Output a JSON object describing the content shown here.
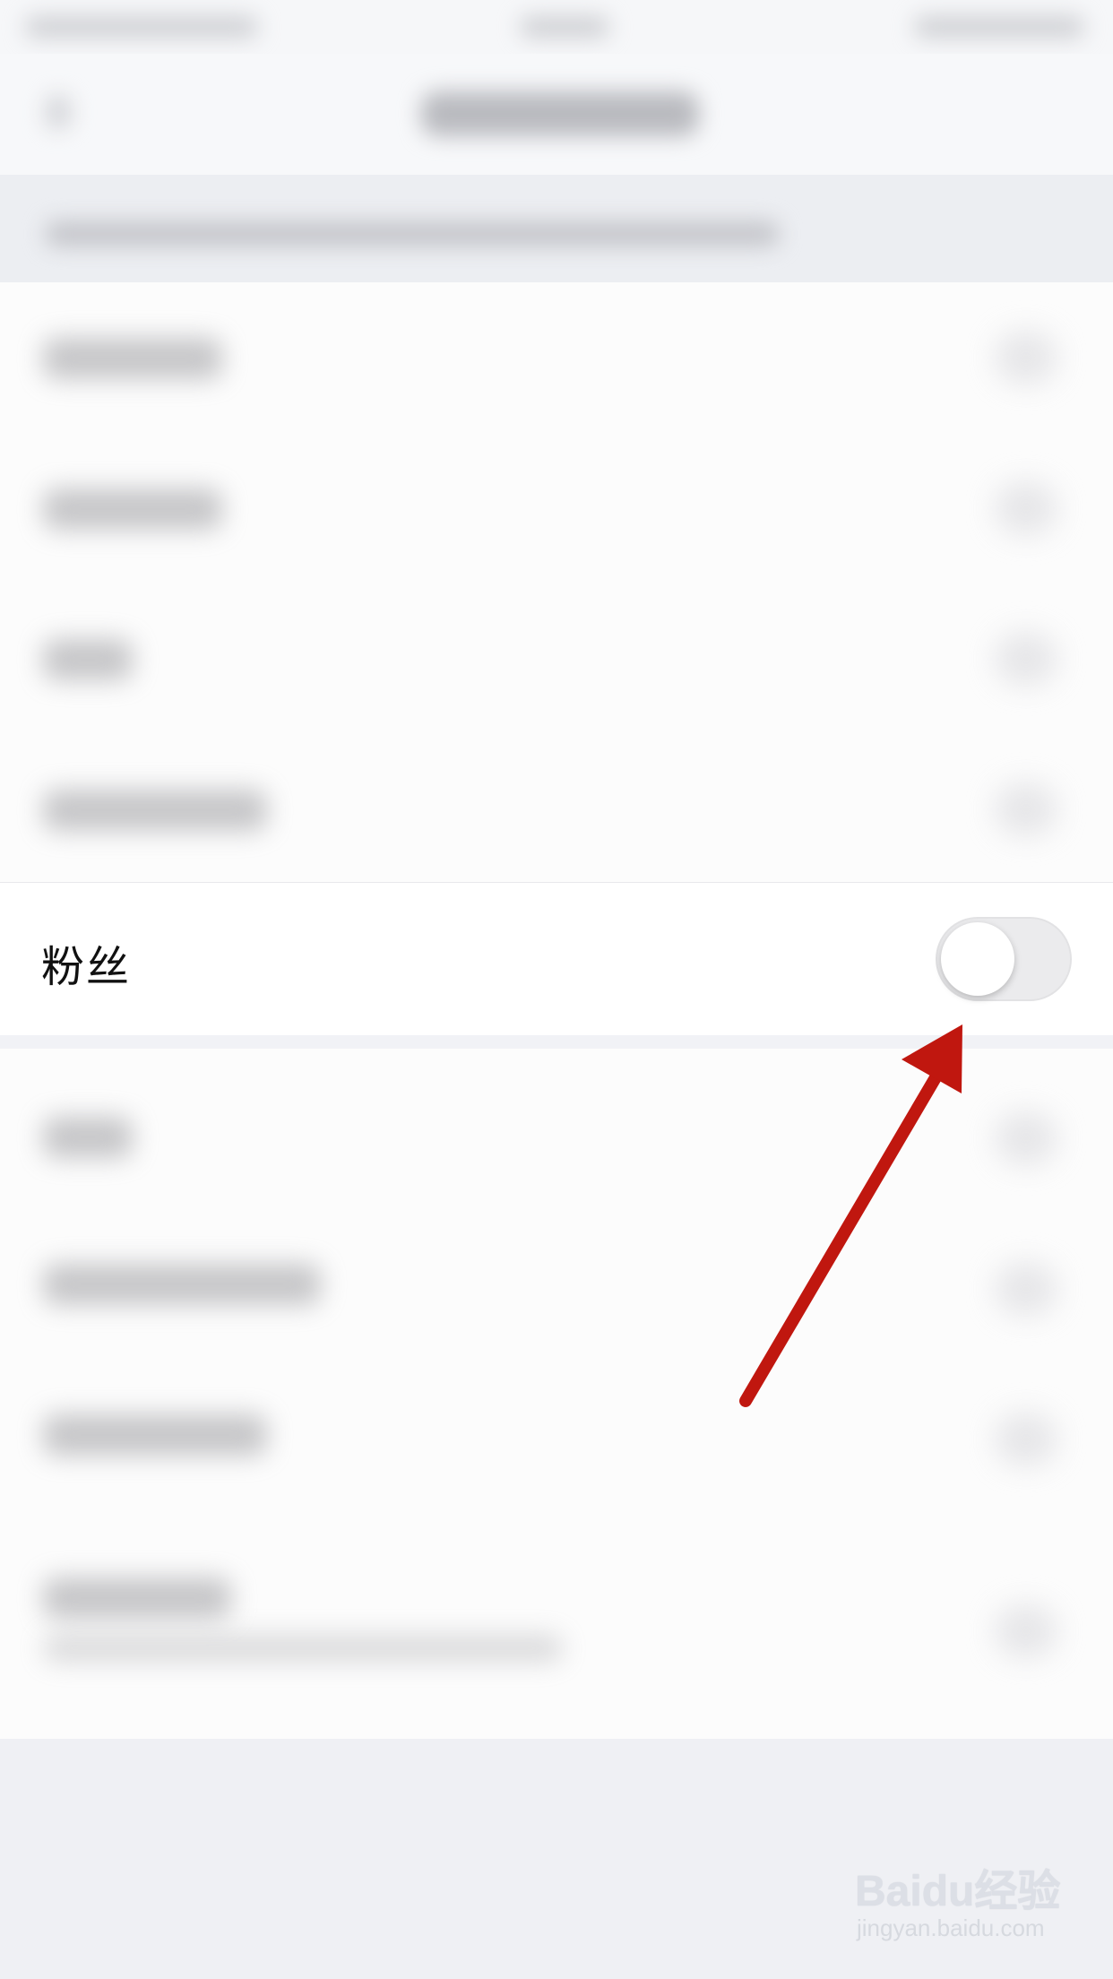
{
  "settings_list": {
    "fans_row": {
      "label": "粉丝",
      "toggle": {
        "state": "off"
      }
    }
  },
  "annotation": {
    "arrow_color": "#c0170f"
  },
  "watermark": {
    "logo": "Baidu经验",
    "url": "jingyan.baidu.com"
  }
}
